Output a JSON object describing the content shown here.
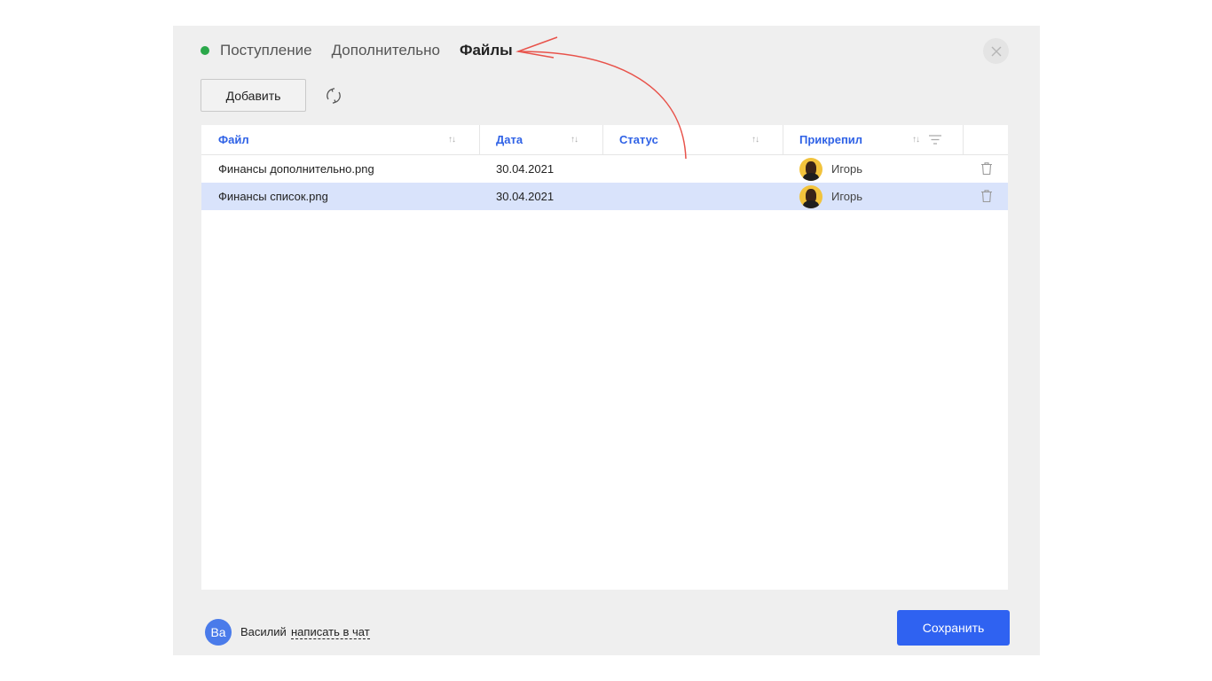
{
  "tabs": [
    {
      "label": "Поступление"
    },
    {
      "label": "Дополнительно"
    },
    {
      "label": "Файлы",
      "active": true
    }
  ],
  "status_color": "#2aa84a",
  "toolbar": {
    "add_label": "Добавить",
    "refresh_icon": "refresh-icon"
  },
  "table": {
    "columns": [
      {
        "label": "Файл"
      },
      {
        "label": "Дата"
      },
      {
        "label": "Статус"
      },
      {
        "label": "Прикрепил"
      }
    ],
    "rows": [
      {
        "file": "Финансы дополнительно.png",
        "date": "30.04.2021",
        "status": "",
        "attached_by": "Игорь",
        "selected": false
      },
      {
        "file": "Финансы список.png",
        "date": "30.04.2021",
        "status": "",
        "attached_by": "Игорь",
        "selected": true
      }
    ]
  },
  "footer": {
    "avatar_initials": "Ва",
    "user_name": "Василий",
    "chat_link": "написать в чат",
    "save_label": "Сохранить"
  },
  "colors": {
    "accent": "#2f62f1",
    "header_text": "#2f62e6",
    "selected_row": "#d9e3fb",
    "annotation_arrow": "#e8524a"
  }
}
